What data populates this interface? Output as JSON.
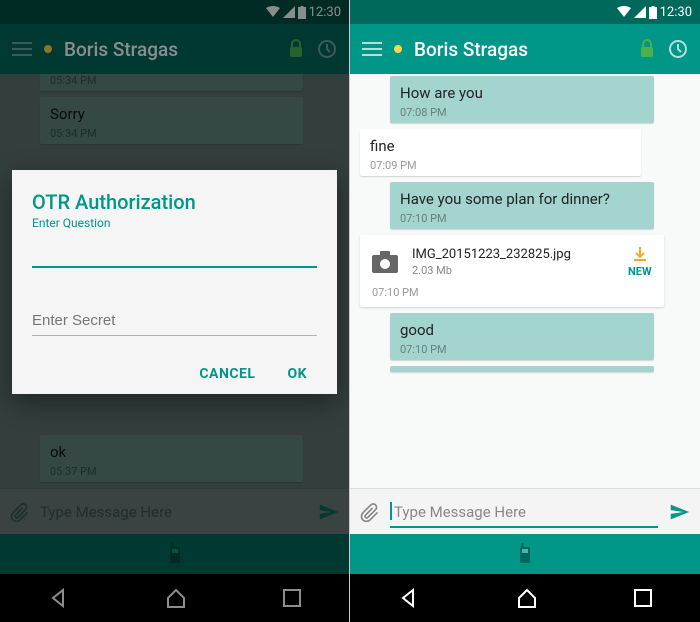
{
  "status": {
    "time": "12:30"
  },
  "left": {
    "contact": "Boris  Stragas",
    "messages": [
      {
        "type": "out",
        "text": "",
        "time": "05:34 PM",
        "partial": true
      },
      {
        "type": "out",
        "text": "Sorry",
        "time": "05:34 PM"
      },
      {
        "type": "out",
        "text": "ok",
        "time": "05:37 PM",
        "partial_bottom": true
      }
    ],
    "composer_placeholder": "Type Message Here",
    "dialog": {
      "title": "OTR Authorization",
      "subtitle": "Enter Question",
      "secret_placeholder": "Enter Secret",
      "cancel": "CANCEL",
      "ok": "OK"
    }
  },
  "right": {
    "contact": "Boris Stragas",
    "messages": [
      {
        "type": "out",
        "text": "How are you",
        "time": "07:08 PM"
      },
      {
        "type": "in",
        "text": "fine",
        "time": "07:09 PM"
      },
      {
        "type": "out",
        "text": "Have you some plan for dinner?",
        "time": "07:10 PM"
      },
      {
        "type": "attachment",
        "file": "IMG_20151223_232825.jpg",
        "size": "2.03 Mb",
        "badge": "NEW",
        "time": "07:10 PM"
      },
      {
        "type": "out",
        "text": "good",
        "time": "07:10 PM"
      }
    ],
    "composer_placeholder": "Type Message Here"
  },
  "icons": {
    "lock": "lock-icon",
    "clock": "clock-icon",
    "camera": "camera-icon",
    "download": "download-icon",
    "attach": "attach-icon",
    "send": "send-icon",
    "walkie": "walkie-icon"
  }
}
